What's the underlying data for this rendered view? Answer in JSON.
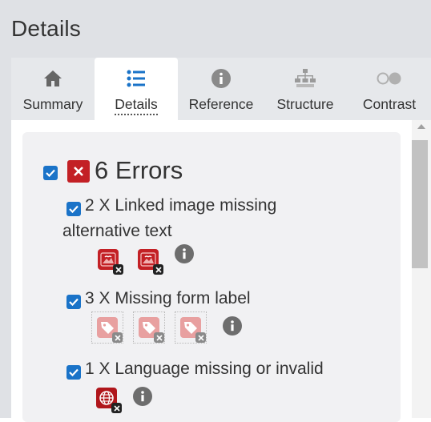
{
  "panel": {
    "title": "Details"
  },
  "tabs": [
    {
      "label": "Summary",
      "icon": "home-icon",
      "active": false
    },
    {
      "label": "Details",
      "icon": "list-icon",
      "active": true
    },
    {
      "label": "Reference",
      "icon": "info-icon",
      "active": false
    },
    {
      "label": "Structure",
      "icon": "sitemap-icon",
      "active": false
    },
    {
      "label": "Contrast",
      "icon": "contrast-toggle-icon",
      "active": false
    }
  ],
  "errors": {
    "header": "6 Errors",
    "checked": true,
    "items": [
      {
        "line1": "2 X Linked image missing",
        "line2": "alternative text",
        "checked": true,
        "icon": "linked-image-error-icon",
        "count": 2
      },
      {
        "line1": "3 X Missing form label",
        "checked": true,
        "icon": "form-label-error-icon",
        "count": 3
      },
      {
        "line1": "1 X Language missing or invalid",
        "checked": true,
        "icon": "language-error-icon",
        "count": 1
      }
    ]
  },
  "colors": {
    "error_red": "#c32025",
    "checkbox_blue": "#1a73c8",
    "light_error_pink": "#e8a0a0",
    "panel_bg": "#dfe1e5"
  }
}
